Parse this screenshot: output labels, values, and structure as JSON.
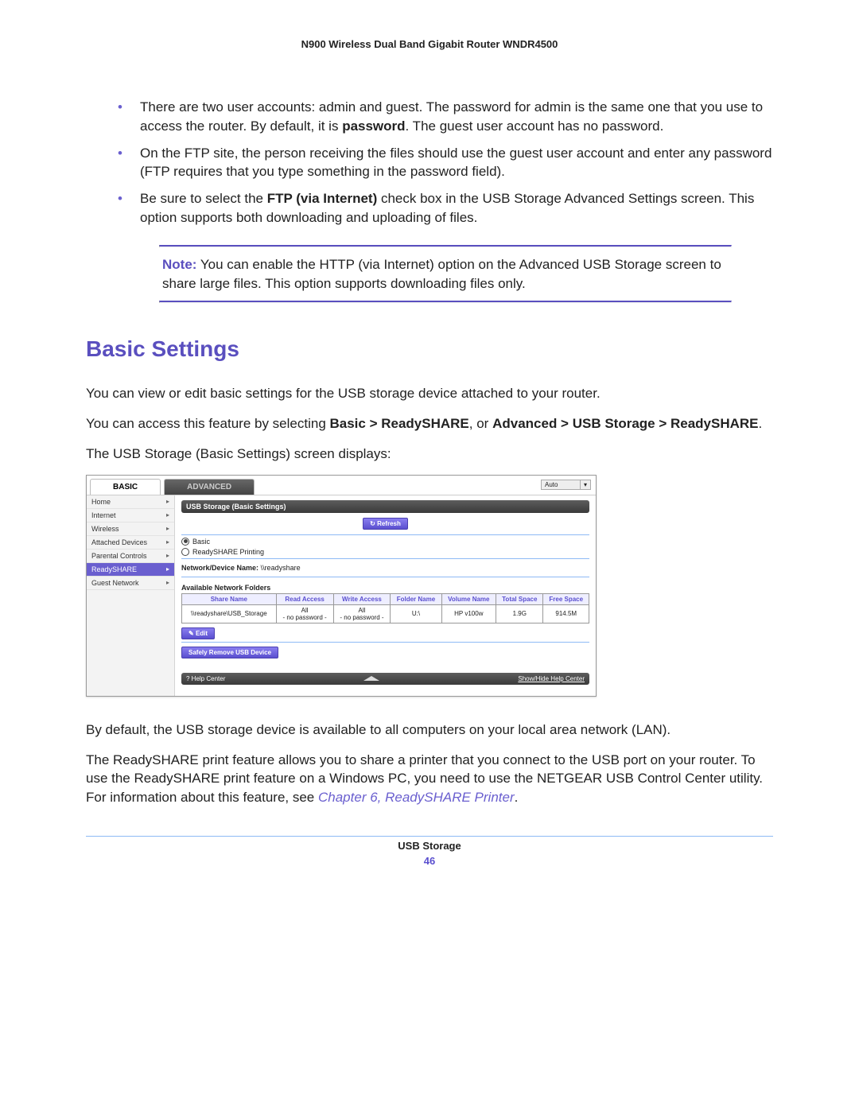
{
  "header": "N900 Wireless Dual Band Gigabit Router WNDR4500",
  "bullets": [
    {
      "pre": "There are two user accounts: admin and guest. The password for admin is the same one that you use to access the router. By default, it is ",
      "bold": "password",
      "post": ". The guest user account has no password."
    },
    {
      "pre": "On the FTP site, the person receiving the files should use the guest user account and enter any password (FTP requires that you type something in the password field).",
      "bold": "",
      "post": ""
    },
    {
      "pre": "Be sure to select the ",
      "bold": "FTP (via Internet)",
      "post": " check box in the USB Storage Advanced Settings screen. This option supports both downloading and uploading of files."
    }
  ],
  "note": {
    "label": "Note:",
    "text": " You can enable the HTTP (via Internet) option on the Advanced USB Storage screen to share large files. This option supports downloading files only."
  },
  "section_title": "Basic Settings",
  "para1": "You can view or edit basic settings for the USB storage device attached to your router.",
  "para2": {
    "pre": "You can access this feature by selecting ",
    "b1": "Basic > ReadySHARE",
    "mid": ", or ",
    "b2": "Advanced > USB Storage > ReadySHARE",
    "post": "."
  },
  "para3": "The USB Storage (Basic Settings) screen displays:",
  "shot": {
    "tab_basic": "BASIC",
    "tab_adv": "ADVANCED",
    "dropdown": "Auto",
    "sidebar": [
      "Home",
      "Internet",
      "Wireless",
      "Attached Devices",
      "Parental Controls",
      "ReadySHARE",
      "Guest Network"
    ],
    "sidebar_active": 5,
    "panel_title": "USB Storage (Basic Settings)",
    "refresh": "Refresh",
    "radio_basic": "Basic",
    "radio_print": "ReadySHARE Printing",
    "devname_label": "Network/Device Name:",
    "devname_value": "\\\\readyshare",
    "folders_label": "Available Network Folders",
    "cols": [
      "Share Name",
      "Read Access",
      "Write Access",
      "Folder Name",
      "Volume Name",
      "Total Space",
      "Free Space"
    ],
    "row": [
      "\\\\readyshare\\USB_Storage",
      "All\n- no password -",
      "All\n- no password -",
      "U:\\",
      "HP v100w",
      "1.9G",
      "914.5M"
    ],
    "edit": "Edit",
    "safely": "Safely Remove USB Device",
    "helpcenter": "Help Center",
    "showhide": "Show/Hide Help Center"
  },
  "para4": "By default, the USB storage device is available to all computers on your local area network (LAN).",
  "para5": {
    "pre": "The ReadySHARE print feature allows you to share a printer that you connect to the USB port on your router. To use the ReadySHARE print feature on a Windows PC, you need to use the NETGEAR USB Control Center utility. For information about this feature, see ",
    "link": "Chapter 6, ReadySHARE Printer",
    "post": "."
  },
  "footer_title": "USB Storage",
  "page_number": "46"
}
